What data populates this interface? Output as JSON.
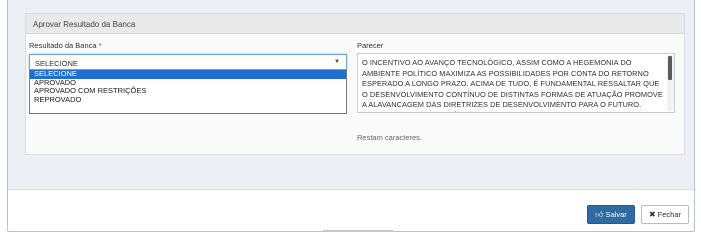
{
  "panel": {
    "title": "Aprovar Resultado da Banca"
  },
  "resultado": {
    "label": "Resultado da Banca",
    "required_mark": "*",
    "selected": "SELECIONE",
    "options": [
      "SELECIONE",
      "APROVADO",
      "APROVADO COM RESTRIÇÕES",
      "REPROVADO"
    ],
    "highlighted_index": 0
  },
  "parecer": {
    "label": "Parecer",
    "text": "O INCENTIVO AO AVANÇO TECNOLÓGICO, ASSIM COMO A HEGEMONIA DO AMBIENTE POLÍTICO MAXIMIZA AS POSSIBILIDADES POR CONTA DO RETORNO ESPERADO A LONGO PRAZO. ACIMA DE TUDO, É FUNDAMENTAL RESSALTAR QUE O DESENVOLVIMENTO CONTÍNUO DE DISTINTAS FORMAS DE ATUAÇÃO PROMOVE A ALAVANCAGEM DAS DIRETRIZES DE DESENVOLVIMENTO PARA O FUTURO. EVIDENTEMENTE, O FENÔMENO DA",
    "counter_text": "Restam caracteres."
  },
  "footer": {
    "save_label": "Salvar",
    "close_label": "Fechar"
  },
  "icons": {
    "save": "thumbs-up-icon",
    "close": "close-icon",
    "caret": "caret-down-icon"
  },
  "colors": {
    "primary": "#2f6aa0",
    "option_highlight": "#1e6fd1",
    "required": "#c0392b"
  }
}
